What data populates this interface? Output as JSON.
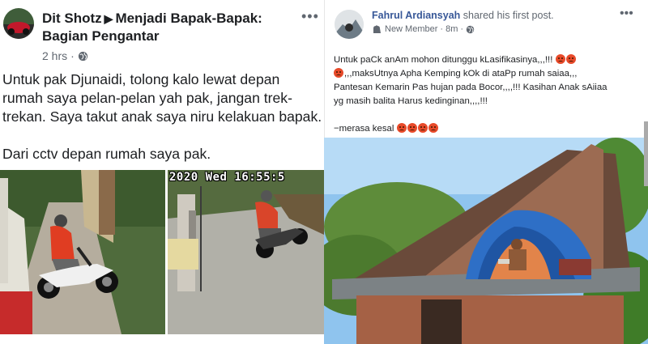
{
  "left_post": {
    "author": "Dit Shotz",
    "group": "Menjadi Bapak-Bapak: Bagian Pengantar",
    "time": "2 hrs",
    "body": [
      "Untuk pak Djunaidi, tolong kalo lewat depan rumah saya pelan-pelan yah pak, jangan trek-trekan. Saya takut anak saya niru kelakuan bapak.",
      "Dari cctv depan rumah saya pak."
    ],
    "cctv_timestamp": "2020 Wed 16:55:5"
  },
  "right_post": {
    "author": "Fahrul Ardiansyah",
    "action": "shared his first post.",
    "badge": "New Member",
    "time": "8m",
    "lines": [
      "Untuk paCk anAm mohon ditunggu kLasifikasinya,,,!!!",
      ",,,maksUtnya Apha Kemping kOk di ataPp rumah saiaa,,,",
      "Pantesan Kemarin Pas hujan pada Bocor,,,,!!! Kasihan Anak sAiiaa",
      "yg masih balita Harus kedinginan,,,,!!!",
      "",
      "−merasa kesal"
    ]
  },
  "icons": {
    "privacy": "globe-icon",
    "more": "more-options-icon",
    "emoji": "angry-face-icon",
    "badge": "new-member-icon"
  }
}
